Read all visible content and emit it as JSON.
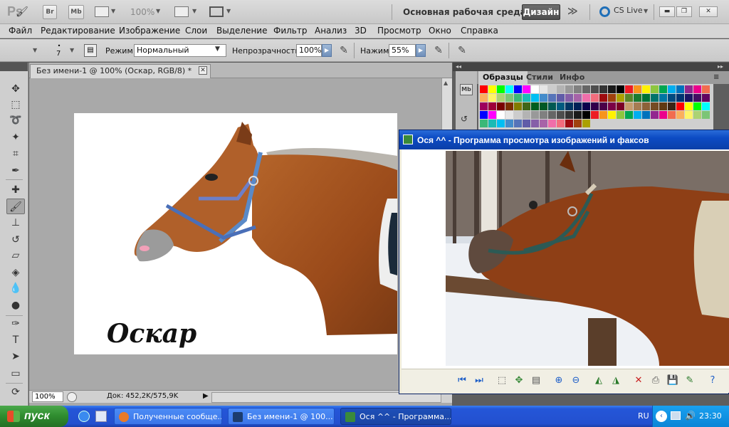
{
  "appbar": {
    "logo": "Ps",
    "bridge": "Br",
    "minibridge": "Mb",
    "zoom": "100%",
    "workspace": "Основная рабочая среда",
    "design": "Дизайн",
    "more": "≫",
    "cslive": "CS Live",
    "ctl_min": "▬",
    "ctl_restore": "❐",
    "ctl_close": "✕"
  },
  "menu": {
    "items": [
      "Файл",
      "Редактирование",
      "Изображение",
      "Слои",
      "Выделение",
      "Фильтр",
      "Анализ",
      "3D",
      "Просмотр",
      "Окно",
      "Справка"
    ]
  },
  "options": {
    "brush_size": "7",
    "mode_label": "Режим:",
    "mode_value": "Нормальный",
    "opacity_label": "Непрозрачность:",
    "opacity_value": "100%",
    "pressure_label": "Нажим:",
    "pressure_value": "55%"
  },
  "document": {
    "tab_title": "Без имени-1 @ 100% (Оскар, RGB/8) *",
    "close": "✕",
    "zoom": "100%",
    "info": "Док: 452,2K/575,9K",
    "signature": "Оскар"
  },
  "panel": {
    "tabs": [
      "Образцы",
      "Стили",
      "Инфо"
    ]
  },
  "viewer": {
    "title": "Ося ^^ - Программа просмотра изображений и факсов"
  },
  "taskbar": {
    "start": "пуск",
    "tasks": [
      "Полученные сообще...",
      "Без имени-1 @ 100...",
      "Ося ^^ - Программа..."
    ],
    "lang": "RU",
    "time": "23:30"
  },
  "colors": {
    "xp_blue": "#2456d8",
    "start_green": "#2e8b2e",
    "horse_brown": "#a0521e"
  }
}
